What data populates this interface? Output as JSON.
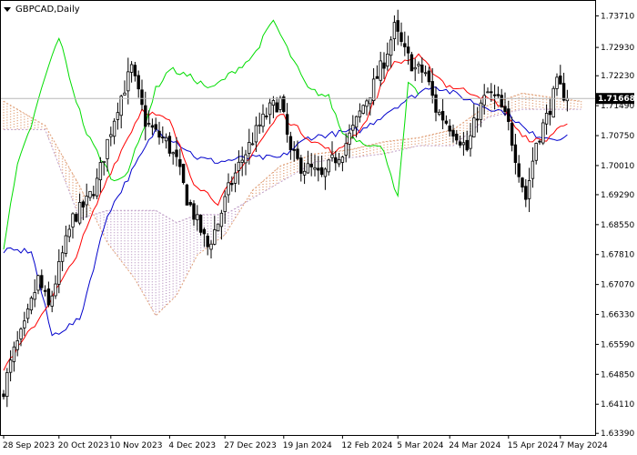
{
  "chart_data": {
    "type": "candlestick",
    "title": "GBPCAD,Daily",
    "current_price": 1.71668,
    "y_ticks": [
      "1.73710",
      "1.72930",
      "1.72230",
      "1.71490",
      "1.70750",
      "1.70010",
      "1.69290",
      "1.68550",
      "1.67810",
      "1.67070",
      "1.66330",
      "1.65590",
      "1.64850",
      "1.64110",
      "1.63390"
    ],
    "ylim": [
      1.6335,
      1.7408
    ],
    "x_ticks": [
      {
        "label": "28 Sep 2023",
        "index": 0
      },
      {
        "label": "20 Oct 2023",
        "index": 16
      },
      {
        "label": "10 Nov 2023",
        "index": 31
      },
      {
        "label": "4 Dec 2023",
        "index": 48
      },
      {
        "label": "27 Dec 2023",
        "index": 64
      },
      {
        "label": "19 Jan 2024",
        "index": 81
      },
      {
        "label": "12 Feb 2024",
        "index": 98
      },
      {
        "label": "5 Mar 2024",
        "index": 114
      },
      {
        "label": "24 Mar 2024",
        "index": 129
      },
      {
        "label": "15 Apr 2024",
        "index": 146
      },
      {
        "label": "7 May 2024",
        "index": 161
      }
    ],
    "close_anchors": [
      [
        0,
        1.645
      ],
      [
        3,
        1.654
      ],
      [
        6,
        1.66
      ],
      [
        10,
        1.672
      ],
      [
        13,
        1.665
      ],
      [
        17,
        1.678
      ],
      [
        20,
        1.687
      ],
      [
        24,
        1.691
      ],
      [
        27,
        1.696
      ],
      [
        30,
        1.706
      ],
      [
        33,
        1.715
      ],
      [
        37,
        1.724
      ],
      [
        41,
        1.711
      ],
      [
        44,
        1.708
      ],
      [
        47,
        1.706
      ],
      [
        50,
        1.701
      ],
      [
        53,
        1.692
      ],
      [
        56,
        1.686
      ],
      [
        59,
        1.68
      ],
      [
        62,
        1.686
      ],
      [
        65,
        1.694
      ],
      [
        68,
        1.7
      ],
      [
        71,
        1.705
      ],
      [
        74,
        1.71
      ],
      [
        77,
        1.714
      ],
      [
        80,
        1.716
      ],
      [
        83,
        1.703
      ],
      [
        86,
        1.7
      ],
      [
        89,
        1.699
      ],
      [
        92,
        1.697
      ],
      [
        95,
        1.701
      ],
      [
        98,
        1.704
      ],
      [
        101,
        1.709
      ],
      [
        104,
        1.715
      ],
      [
        107,
        1.72
      ],
      [
        110,
        1.726
      ],
      [
        113,
        1.734
      ],
      [
        116,
        1.728
      ],
      [
        119,
        1.724
      ],
      [
        122,
        1.723
      ],
      [
        125,
        1.714
      ],
      [
        128,
        1.711
      ],
      [
        131,
        1.708
      ],
      [
        134,
        1.704
      ],
      [
        137,
        1.713
      ],
      [
        140,
        1.718
      ],
      [
        143,
        1.716
      ],
      [
        146,
        1.71
      ],
      [
        149,
        1.699
      ],
      [
        151,
        1.692
      ],
      [
        154,
        1.706
      ],
      [
        157,
        1.712
      ],
      [
        160,
        1.72
      ],
      [
        163,
        1.7167
      ]
    ],
    "tenkan_anchors": [
      [
        0,
        1.65
      ],
      [
        10,
        1.662
      ],
      [
        20,
        1.676
      ],
      [
        30,
        1.697
      ],
      [
        40,
        1.714
      ],
      [
        48,
        1.711
      ],
      [
        55,
        1.696
      ],
      [
        62,
        1.691
      ],
      [
        70,
        1.701
      ],
      [
        80,
        1.713
      ],
      [
        88,
        1.707
      ],
      [
        96,
        1.703
      ],
      [
        104,
        1.71
      ],
      [
        112,
        1.725
      ],
      [
        120,
        1.727
      ],
      [
        128,
        1.72
      ],
      [
        136,
        1.718
      ],
      [
        144,
        1.715
      ],
      [
        150,
        1.707
      ],
      [
        156,
        1.706
      ],
      [
        163,
        1.711
      ]
    ],
    "kijun_anchors": [
      [
        0,
        1.679
      ],
      [
        8,
        1.679
      ],
      [
        14,
        1.658
      ],
      [
        22,
        1.662
      ],
      [
        30,
        1.688
      ],
      [
        38,
        1.7
      ],
      [
        44,
        1.709
      ],
      [
        50,
        1.706
      ],
      [
        56,
        1.702
      ],
      [
        62,
        1.701
      ],
      [
        70,
        1.702
      ],
      [
        80,
        1.702
      ],
      [
        88,
        1.707
      ],
      [
        96,
        1.708
      ],
      [
        104,
        1.709
      ],
      [
        112,
        1.714
      ],
      [
        118,
        1.717
      ],
      [
        124,
        1.72
      ],
      [
        130,
        1.718
      ],
      [
        138,
        1.715
      ],
      [
        146,
        1.713
      ],
      [
        152,
        1.708
      ],
      [
        158,
        1.707
      ],
      [
        163,
        1.707
      ]
    ],
    "chikou_anchors": [
      [
        0,
        1.68
      ],
      [
        4,
        1.7
      ],
      [
        8,
        1.71
      ],
      [
        12,
        1.722
      ],
      [
        16,
        1.732
      ],
      [
        20,
        1.719
      ],
      [
        24,
        1.708
      ],
      [
        28,
        1.702
      ],
      [
        32,
        1.696
      ],
      [
        36,
        1.699
      ],
      [
        40,
        1.708
      ],
      [
        44,
        1.719
      ],
      [
        48,
        1.724
      ],
      [
        54,
        1.722
      ],
      [
        60,
        1.719
      ],
      [
        66,
        1.723
      ],
      [
        72,
        1.727
      ],
      [
        78,
        1.736
      ],
      [
        82,
        1.729
      ],
      [
        88,
        1.719
      ],
      [
        94,
        1.717
      ],
      [
        98,
        1.708
      ],
      [
        104,
        1.706
      ],
      [
        110,
        1.704
      ],
      [
        114,
        1.692
      ],
      [
        117,
        1.72
      ],
      [
        120,
        1.718
      ]
    ],
    "span_a_anchors": [
      [
        0,
        1.716
      ],
      [
        12,
        1.71
      ],
      [
        22,
        1.695
      ],
      [
        30,
        1.681
      ],
      [
        38,
        1.672
      ],
      [
        44,
        1.663
      ],
      [
        50,
        1.668
      ],
      [
        56,
        1.678
      ],
      [
        64,
        1.683
      ],
      [
        72,
        1.694
      ],
      [
        80,
        1.7
      ],
      [
        90,
        1.703
      ],
      [
        100,
        1.704
      ],
      [
        110,
        1.706
      ],
      [
        120,
        1.707
      ],
      [
        130,
        1.709
      ],
      [
        140,
        1.715
      ],
      [
        150,
        1.718
      ],
      [
        158,
        1.717
      ],
      [
        167,
        1.716
      ]
    ],
    "span_b_anchors": [
      [
        0,
        1.709
      ],
      [
        12,
        1.709
      ],
      [
        22,
        1.687
      ],
      [
        30,
        1.689
      ],
      [
        38,
        1.689
      ],
      [
        44,
        1.689
      ],
      [
        50,
        1.686
      ],
      [
        56,
        1.688
      ],
      [
        64,
        1.688
      ],
      [
        72,
        1.692
      ],
      [
        80,
        1.696
      ],
      [
        90,
        1.701
      ],
      [
        100,
        1.702
      ],
      [
        110,
        1.703
      ],
      [
        120,
        1.705
      ],
      [
        130,
        1.705
      ],
      [
        140,
        1.712
      ],
      [
        150,
        1.714
      ],
      [
        158,
        1.714
      ],
      [
        167,
        1.714
      ]
    ],
    "colors": {
      "bull_fill": "#ffffff",
      "bear_fill": "#000000",
      "candle_stroke": "#000000",
      "tenkan": "#ff0000",
      "kijun": "#0000cc",
      "chikou": "#00dd00",
      "cloud_bull": "#e0a078",
      "cloud_bear": "#c0a0c8",
      "price_line": "#b8b8b8",
      "price_label_bg": "#000000",
      "axis": "#000000"
    },
    "grid": false
  }
}
